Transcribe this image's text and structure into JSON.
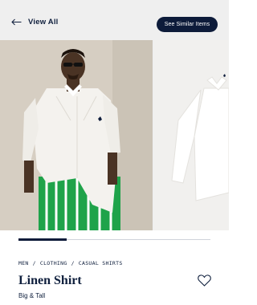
{
  "header": {
    "back_label": "View All",
    "similar_label": "See Similar Items"
  },
  "gallery": {
    "progress": 0.25
  },
  "product": {
    "breadcrumb": [
      "MEN",
      "CLOTHING",
      "CASUAL SHIRTS"
    ],
    "breadcrumb_separator": "/",
    "title": "Linen Shirt",
    "subtitle": "Big & Tall"
  },
  "colors": {
    "navy": "#0d1b3a",
    "background": "#efefef",
    "shorts_green": "#1fa34a"
  },
  "icons": {
    "back": "arrow-left-icon",
    "favorite": "heart-icon"
  }
}
